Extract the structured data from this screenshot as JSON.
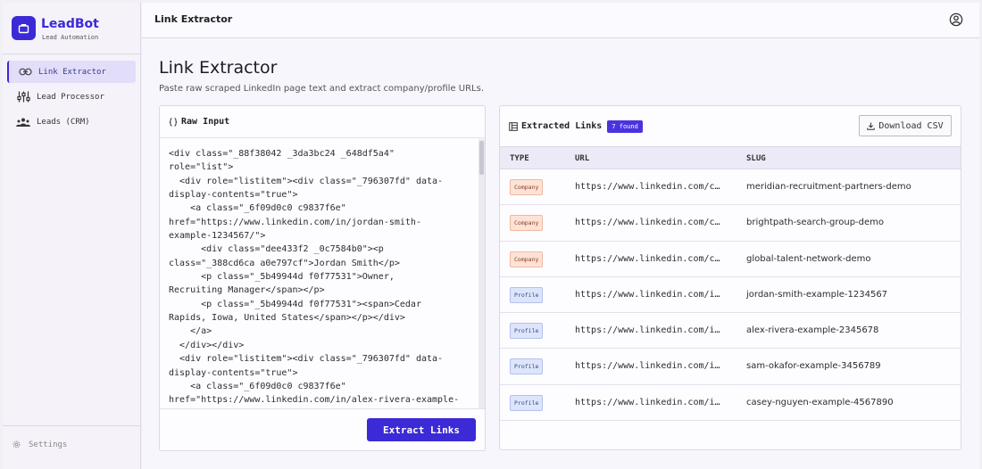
{
  "app": {
    "name": "LeadBot",
    "subtitle": "Lead Automation"
  },
  "sidebar": {
    "items": [
      {
        "label": "Link Extractor",
        "icon": "link-icon",
        "active": true
      },
      {
        "label": "Lead Processor",
        "icon": "sliders-icon",
        "active": false
      },
      {
        "label": "Leads (CRM)",
        "icon": "users-icon",
        "active": false
      }
    ],
    "settings_label": "Settings"
  },
  "topbar": {
    "title": "Link Extractor"
  },
  "page": {
    "title": "Link Extractor",
    "subtitle": "Paste raw scraped LinkedIn page text and extract company/profile URLs."
  },
  "raw_input": {
    "title": "Raw Input",
    "lines": [
      "<div class=\"_88f38042 _3da3bc24 _648df5a4\"",
      "role=\"list\">",
      "  <div role=\"listitem\"><div class=\"_796307fd\" data-",
      "display-contents=\"true\">",
      "    <a class=\"_6f09d0c0 c9837f6e\"",
      "href=\"https://www.linkedin.com/in/jordan-smith-",
      "example-1234567/\">",
      "      <div class=\"dee433f2 _0c7584b0\"><p",
      "class=\"_388cd6ca a0e797cf\">Jordan Smith</p>",
      "      <p class=\"_5b49944d f0f77531\">Owner,",
      "Recruiting Manager</span></p>",
      "      <p class=\"_5b49944d f0f77531\"><span>Cedar",
      "Rapids, Iowa, United States</span></p></div>",
      "    </a>",
      "  </div></div>",
      "  <div role=\"listitem\"><div class=\"_796307fd\" data-",
      "display-contents=\"true\">",
      "    <a class=\"_6f09d0c0 c9837f6e\"",
      "href=\"https://www.linkedin.com/in/alex-rivera-example-"
    ],
    "button_label": "Extract Links"
  },
  "links": {
    "title": "Extracted Links",
    "count_label": "7 found",
    "download_label": "Download CSV",
    "columns": [
      "TYPE",
      "URL",
      "SLUG"
    ],
    "rows": [
      {
        "type": "Company",
        "url": "https://www.linkedin.com/c…",
        "slug": "meridian-recruitment-partners-demo"
      },
      {
        "type": "Company",
        "url": "https://www.linkedin.com/c…",
        "slug": "brightpath-search-group-demo"
      },
      {
        "type": "Company",
        "url": "https://www.linkedin.com/c…",
        "slug": "global-talent-network-demo"
      },
      {
        "type": "Profile",
        "url": "https://www.linkedin.com/i…",
        "slug": "jordan-smith-example-1234567"
      },
      {
        "type": "Profile",
        "url": "https://www.linkedin.com/i…",
        "slug": "alex-rivera-example-2345678"
      },
      {
        "type": "Profile",
        "url": "https://www.linkedin.com/i…",
        "slug": "sam-okafor-example-3456789"
      },
      {
        "type": "Profile",
        "url": "https://www.linkedin.com/i…",
        "slug": "casey-nguyen-example-4567890"
      }
    ]
  },
  "colors": {
    "accent": "#3b2ad6",
    "company_badge": "#fde2d6",
    "profile_badge": "#dde5fb"
  }
}
